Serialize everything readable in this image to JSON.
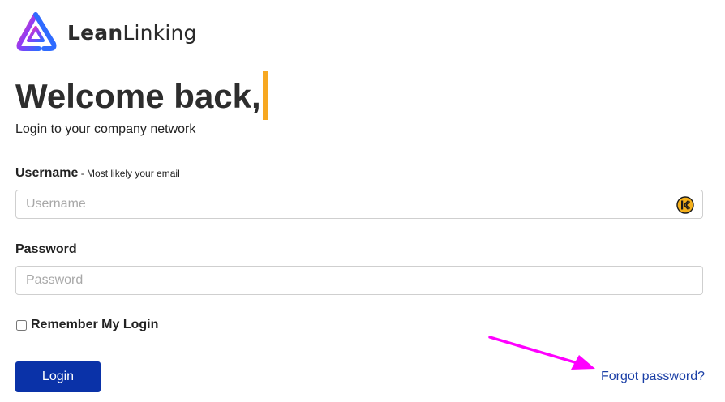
{
  "brand": {
    "name_bold": "Lean",
    "name_rest": "Linking",
    "logo_icon": "triangle-logo-icon"
  },
  "colors": {
    "accent": "#f7a821",
    "primary_button": "#0a32a8",
    "link": "#1a3fa6",
    "annotation_arrow": "#ff00ff"
  },
  "header": {
    "headline": "Welcome back,",
    "subtitle": "Login to your company network"
  },
  "form": {
    "username": {
      "label": "Username",
      "hint": " - Most likely your email",
      "placeholder": "Username",
      "value": "",
      "icon": "keeper-password-manager-icon"
    },
    "password": {
      "label": "Password",
      "placeholder": "Password",
      "value": ""
    },
    "remember": {
      "label": "Remember My Login",
      "checked": false
    },
    "login_label": "Login",
    "forgot_label": "Forgot password?"
  }
}
